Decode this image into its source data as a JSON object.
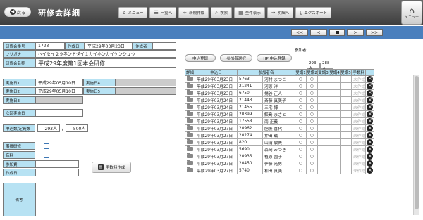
{
  "header": {
    "back_label": "戻る",
    "title": "研修会詳細",
    "toolbar": [
      {
        "icon": "home-icon",
        "glyph": "⌂",
        "label": "メニュー"
      },
      {
        "icon": "list-icon",
        "glyph": "☰",
        "label": "一覧へ"
      },
      {
        "icon": "plus-icon",
        "glyph": "+",
        "label": "新規作成"
      },
      {
        "icon": "search-icon",
        "glyph": "⌕",
        "label": "検索"
      },
      {
        "icon": "grid-icon",
        "glyph": "▦",
        "label": "全件表示"
      },
      {
        "icon": "arrow-right-icon",
        "glyph": "➜",
        "label": "明細へ"
      },
      {
        "icon": "export-icon",
        "glyph": "⤓",
        "label": "エクスポート"
      }
    ],
    "menu_label": "メニュー"
  },
  "pager": {
    "first": "<<",
    "prev": "<",
    "next": ">",
    "last": ">>"
  },
  "form": {
    "id_label": "研修会番号",
    "id_value": "1723",
    "created_label": "作成日",
    "created_value": "平成29年03月23日",
    "author_label": "作成者",
    "author_value": "",
    "furigana_label": "フリガナ",
    "furigana_value": "ヘイセイ２９ネンドダイ１カイホンカイケンシュウ",
    "name_label": "研修会名称",
    "name_value": "平成29年度第1回本会研修",
    "day1_label": "実施日1",
    "day1_value": "平成29年05月10日",
    "day2_label": "実施日2",
    "day2_value": "平成29年05月10日",
    "day3_label": "実施日3",
    "day3_value": "",
    "day4_label": "実施日4",
    "day4_value": "",
    "day5_label": "実施日5",
    "day5_value": "",
    "next_label": "次回実施日",
    "next_value": "",
    "capacity_label": "申込数/定員数",
    "applied": "293人",
    "sep": "/",
    "capacity": "500人",
    "fun_label": "備揮研修",
    "fee_flag_label": "有料",
    "fee_label": "参加費",
    "fee_value": "",
    "made_label": "作成日",
    "made_value": "",
    "remarks_label": "備考",
    "remarks_value": "",
    "fee_button": "手数料作成"
  },
  "participants": {
    "title": "参加者",
    "buttons": [
      "申込登録",
      "参加者選択",
      "HP 申込登録"
    ],
    "count1": "293人",
    "count2": "288人",
    "columns": [
      "詳細",
      "申込日",
      "参加者名",
      "受講1",
      "受講2",
      "受講3",
      "受講4",
      "受講5",
      "手数料"
    ],
    "rows": [
      {
        "date": "平成29年03月23日",
        "no": "5763",
        "name": "河村 まつこ",
        "a1": "○",
        "a2": "○",
        "fee": "未作成"
      },
      {
        "date": "平成29年03月23日",
        "no": "21241",
        "name": "河原 洋一",
        "a1": "○",
        "a2": "○",
        "fee": "未作成"
      },
      {
        "date": "平成29年03月23日",
        "no": "6750",
        "name": "揚谷 正人",
        "a1": "○",
        "a2": "○",
        "fee": "未作成"
      },
      {
        "date": "平成29年03月24日",
        "no": "21443",
        "name": "斎藤 真美子",
        "a1": "○",
        "a2": "○",
        "fee": "未作成"
      },
      {
        "date": "平成29年03月24日",
        "no": "21455",
        "name": "三宅 博",
        "a1": "○",
        "a2": "○",
        "fee": "未作成"
      },
      {
        "date": "平成29年03月24日",
        "no": "20399",
        "name": "鮫島 まさと",
        "a1": "○",
        "a2": "○",
        "fee": "未作成"
      },
      {
        "date": "平成29年03月24日",
        "no": "17558",
        "name": "南 正義",
        "a1": "○",
        "a2": "○",
        "fee": "未作成"
      },
      {
        "date": "平成29年03月27日",
        "no": "20962",
        "name": "肥後 喜代",
        "a1": "○",
        "a2": "○",
        "fee": "未作成"
      },
      {
        "date": "平成29年03月27日",
        "no": "20274",
        "name": "押田 誠",
        "a1": "○",
        "a2": "○",
        "fee": "未作成"
      },
      {
        "date": "平成29年03月27日",
        "no": "820",
        "name": "山浦 敏夫",
        "a1": "○",
        "a2": "○",
        "fee": "未作成"
      },
      {
        "date": "平成29年03月27日",
        "no": "5690",
        "name": "森岡 みづき",
        "a1": "○",
        "a2": "○",
        "fee": "未作成"
      },
      {
        "date": "平成29年03月27日",
        "no": "20935",
        "name": "植原 園子",
        "a1": "○",
        "a2": "○",
        "fee": "未作成"
      },
      {
        "date": "平成29年03月27日",
        "no": "20450",
        "name": "伊藤 光男",
        "a1": "○",
        "a2": "○",
        "fee": "未作成"
      },
      {
        "date": "平成29年03月27日",
        "no": "5740",
        "name": "和田 真美",
        "a1": "○",
        "a2": "○",
        "fee": "未作成"
      }
    ]
  }
}
